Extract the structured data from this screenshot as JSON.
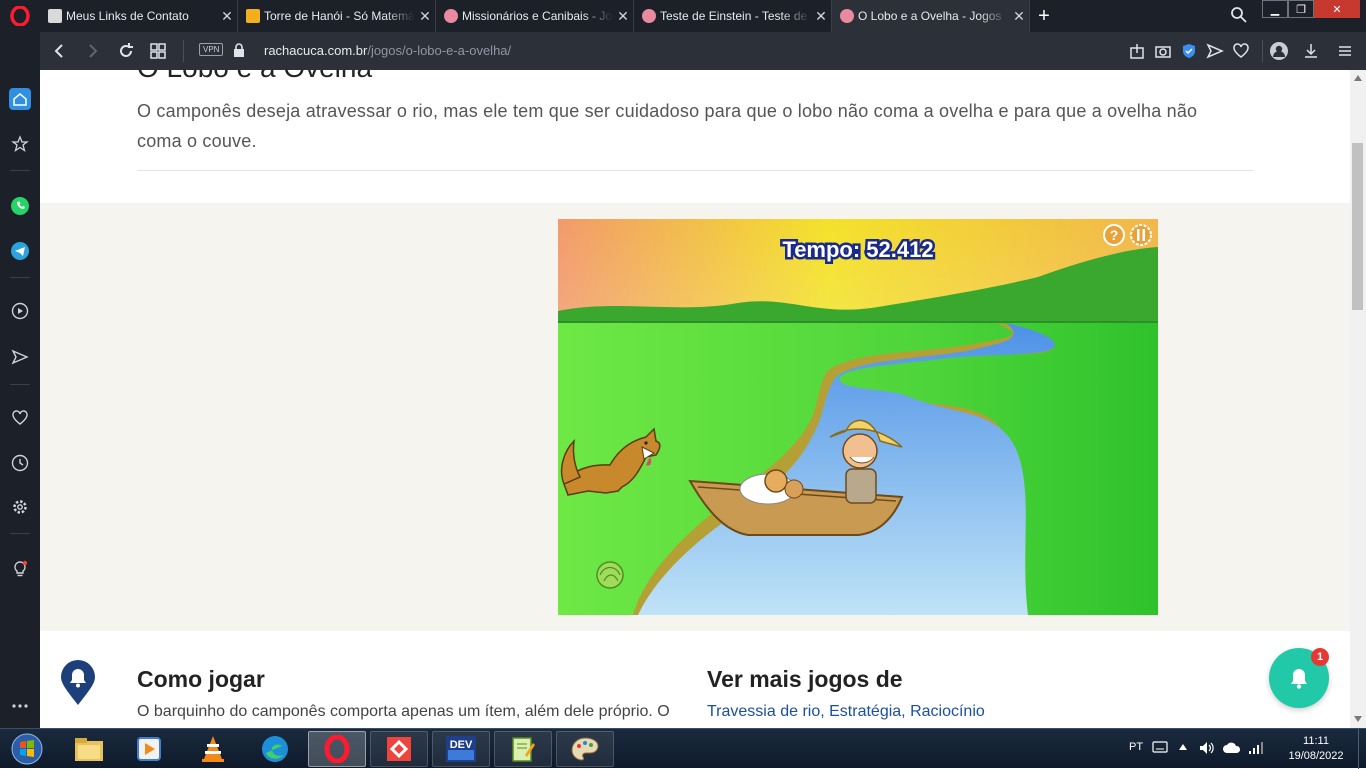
{
  "browser": {
    "tabs": [
      {
        "title": "Meus Links de Contato",
        "active": false,
        "icon": "rr-favicon",
        "icon_color": "#d9d9d9"
      },
      {
        "title": "Torre de Hanói - Só Matemática",
        "active": false,
        "icon": "so-matematica-favicon",
        "icon_color": "#f2b01e"
      },
      {
        "title": "Missionários e Canibais - Jogos",
        "active": false,
        "icon": "brain-favicon",
        "icon_color": "#e88aa0"
      },
      {
        "title": "Teste de Einstein - Teste de",
        "active": false,
        "icon": "brain-favicon",
        "icon_color": "#e88aa0"
      },
      {
        "title": "O Lobo e a Ovelha - Jogos",
        "active": true,
        "icon": "brain-favicon",
        "icon_color": "#e88aa0"
      }
    ],
    "close_glyph": "✕",
    "new_tab_glyph": "+",
    "vpn_label": "VPN",
    "url_host": "rachacuca.com.br",
    "url_path": "/jogos/o-lobo-e-a-ovelha/"
  },
  "page": {
    "title": "O Lobo e a Ovelha",
    "description": "O camponês deseja atravessar o rio, mas ele tem que ser cuidadoso para que o lobo não coma a ovelha e para que a ovelha não coma o couve.",
    "game": {
      "timer_text": "Tempo: 52.412",
      "help_glyph": "?"
    },
    "how_to_play": {
      "title": "Como jogar",
      "text": "O barquinho do camponês comporta apenas um ítem, além dele próprio. O"
    },
    "more_games": {
      "title": "Ver mais jogos de",
      "links": [
        "Travessia de rio",
        "Estratégia",
        "Raciocínio"
      ],
      "separator": ", "
    },
    "notification_count": "1"
  },
  "taskbar": {
    "language": "PT",
    "time": "11:11",
    "date": "19/08/2022",
    "apps": [
      "start-orb",
      "file-explorer",
      "media-player",
      "vlc",
      "edge",
      "opera",
      "anydesk",
      "devcpp",
      "notepad-plus",
      "paint"
    ]
  },
  "colors": {
    "accent_teal": "#22c9a8",
    "opera_red": "#ff1b2d",
    "link_blue": "#1d4fa0",
    "pin_navy": "#1d3f7a"
  }
}
